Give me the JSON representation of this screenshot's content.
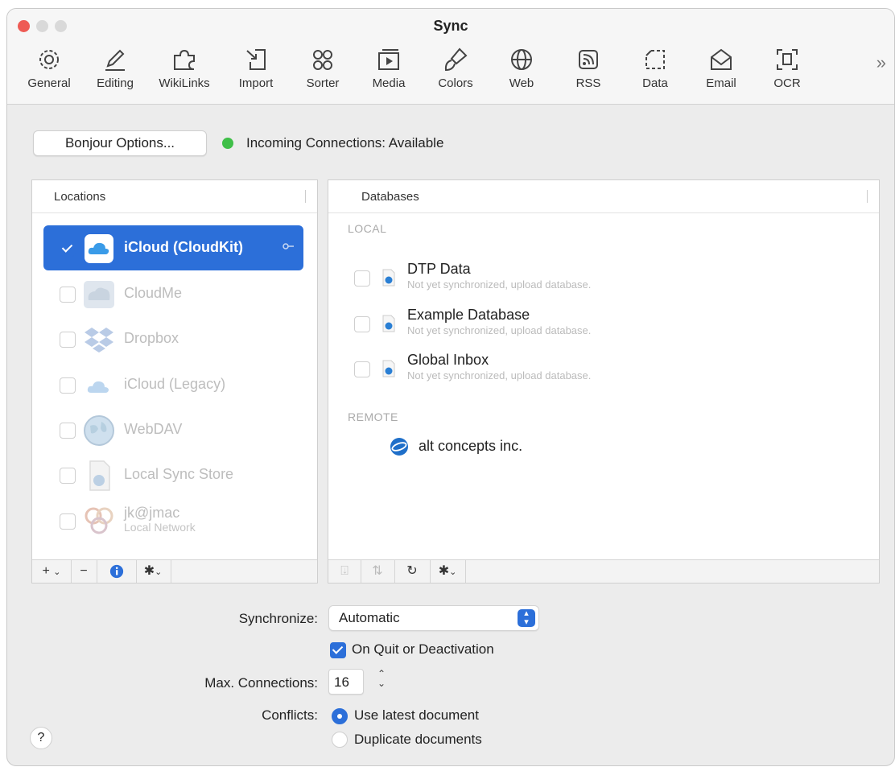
{
  "window": {
    "title": "Sync"
  },
  "toolbar": {
    "items": [
      {
        "label": "General",
        "icon": "gear-icon"
      },
      {
        "label": "Editing",
        "icon": "pencil-icon"
      },
      {
        "label": "WikiLinks",
        "icon": "puzzle-icon"
      },
      {
        "label": "Import",
        "icon": "import-icon"
      },
      {
        "label": "Sorter",
        "icon": "sorter-icon"
      },
      {
        "label": "Media",
        "icon": "media-icon"
      },
      {
        "label": "Colors",
        "icon": "paintbrush-icon"
      },
      {
        "label": "Web",
        "icon": "globe-icon"
      },
      {
        "label": "RSS",
        "icon": "rss-icon"
      },
      {
        "label": "Data",
        "icon": "data-icon"
      },
      {
        "label": "Email",
        "icon": "envelope-icon"
      },
      {
        "label": "OCR",
        "icon": "ocr-icon"
      }
    ],
    "more_label": "»"
  },
  "bonjour": {
    "button_label": "Bonjour Options...",
    "status_text": "Incoming Connections: Available",
    "status_color": "#3fbf48"
  },
  "locations": {
    "header": "Locations",
    "items": [
      {
        "name": "iCloud (CloudKit)",
        "checked": true,
        "selected": true
      },
      {
        "name": "CloudMe",
        "checked": false
      },
      {
        "name": "Dropbox",
        "checked": false
      },
      {
        "name": "iCloud (Legacy)",
        "checked": false
      },
      {
        "name": "WebDAV",
        "checked": false
      },
      {
        "name": "Local Sync Store",
        "checked": false
      },
      {
        "name": "jk@jmac",
        "sub": "Local Network",
        "checked": false
      }
    ]
  },
  "databases": {
    "header": "Databases",
    "local_label": "LOCAL",
    "remote_label": "REMOTE",
    "local": [
      {
        "name": "DTP Data",
        "status": "Not yet synchronized, upload database."
      },
      {
        "name": "Example Database",
        "status": "Not yet synchronized, upload database."
      },
      {
        "name": "Global Inbox",
        "status": "Not yet synchronized, upload database."
      }
    ],
    "remote": [
      {
        "name": "alt concepts inc."
      }
    ]
  },
  "settings": {
    "synchronize_label": "Synchronize:",
    "synchronize_value": "Automatic",
    "on_quit_label": "On Quit or Deactivation",
    "on_quit_checked": true,
    "max_connections_label": "Max. Connections:",
    "max_connections_value": "16",
    "conflicts_label": "Conflicts:",
    "conflict_options": [
      "Use latest document",
      "Duplicate documents"
    ],
    "conflict_selected": 0
  },
  "accent_color": "#2c6fd9",
  "help_label": "?"
}
